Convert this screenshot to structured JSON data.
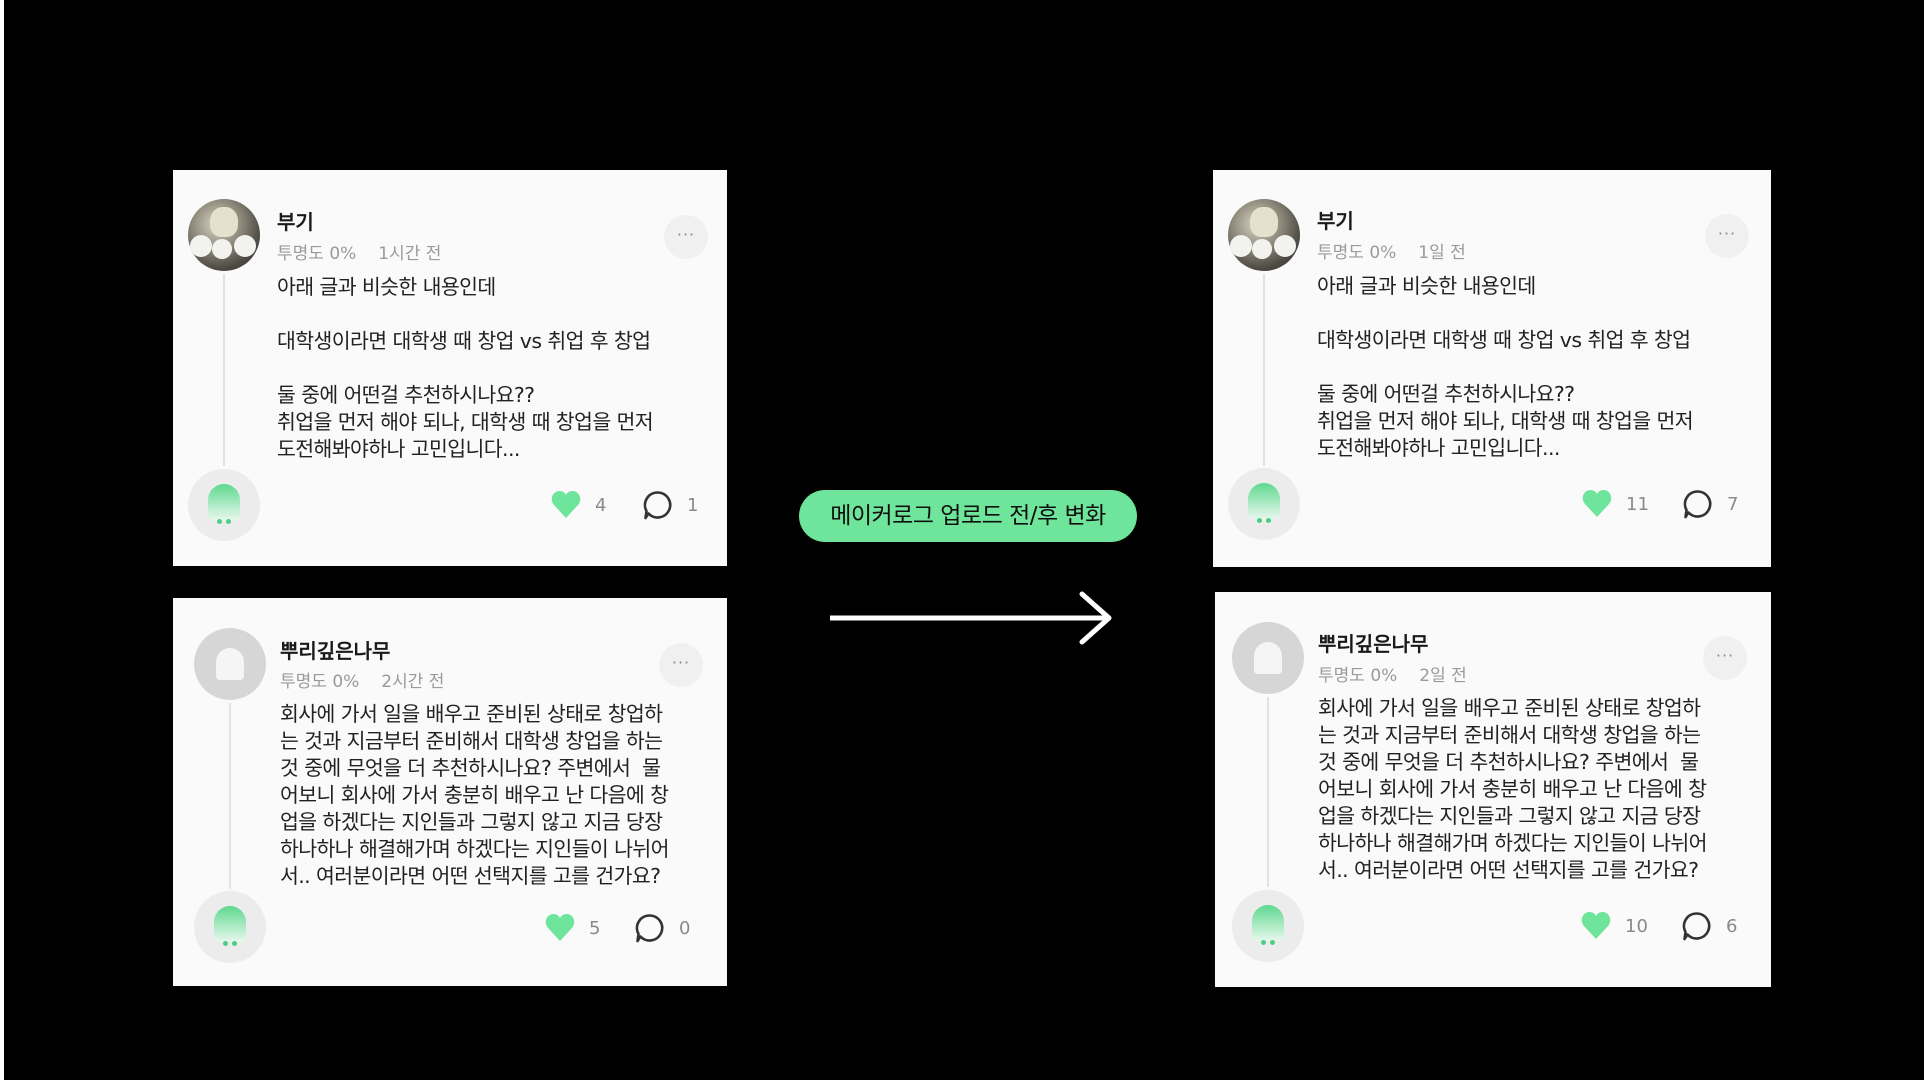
{
  "divider_label": "메이커로그 업로드 전/후 변화",
  "before": {
    "post1": {
      "author": "부기",
      "opacity": "투명도 0%",
      "time": "1시간 전",
      "text": "아래 글과 비슷한 내용인데\n\n대학생이라면 대학생 때 창업 vs 취업 후 창업\n\n둘 중에 어떤걸 추천하시나요??\n취업을 먼저 해야 되나, 대학생 때 창업을 먼저\n도전해봐야하나 고민입니다...",
      "likes": "4",
      "comments": "1"
    },
    "post2": {
      "author": "뿌리깊은나무",
      "opacity": "투명도 0%",
      "time": "2시간 전",
      "text": "회사에 가서 일을 배우고 준비된 상태로 창업하\n는 것과 지금부터 준비해서 대학생 창업을 하는\n것 중에 무엇을 더 추천하시나요? 주변에서  물\n어보니 회사에 가서 충분히 배우고 난 다음에 창\n업을 하겠다는 지인들과 그렇지 않고 지금 당장\n하나하나 해결해가며 하겠다는 지인들이 나뉘어\n서.. 여러분이라면 어떤 선택지를 고를 건가요?",
      "likes": "5",
      "comments": "0"
    }
  },
  "after": {
    "post1": {
      "author": "부기",
      "opacity": "투명도 0%",
      "time": "1일 전",
      "text": "아래 글과 비슷한 내용인데\n\n대학생이라면 대학생 때 창업 vs 취업 후 창업\n\n둘 중에 어떤걸 추천하시나요??\n취업을 먼저 해야 되나, 대학생 때 창업을 먼저\n도전해봐야하나 고민입니다...",
      "likes": "11",
      "comments": "7"
    },
    "post2": {
      "author": "뿌리깊은나무",
      "opacity": "투명도 0%",
      "time": "2일 전",
      "text": "회사에 가서 일을 배우고 준비된 상태로 창업하\n는 것과 지금부터 준비해서 대학생 창업을 하는\n것 중에 무엇을 더 추천하시나요? 주변에서  물\n어보니 회사에 가서 충분히 배우고 난 다음에 창\n업을 하겠다는 지인들과 그렇지 않고 지금 당장\n하나하나 해결해가며 하겠다는 지인들이 나뉘어\n서.. 여러분이라면 어떤 선택지를 고를 건가요?",
      "likes": "10",
      "comments": "6"
    }
  },
  "more_label": "···",
  "colors": {
    "background": "#000000",
    "card": "#fafafa",
    "accent": "#6ee59a",
    "heart": "#6ee59a"
  },
  "icons": {
    "more": "more-icon",
    "like": "heart-icon",
    "comment": "comment-icon",
    "arrow": "arrow-right-icon"
  }
}
